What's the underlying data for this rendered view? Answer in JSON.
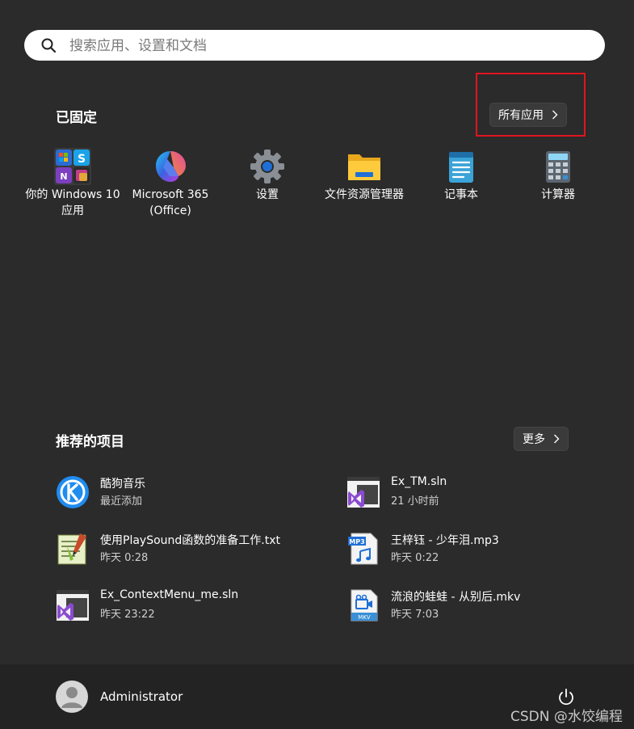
{
  "search": {
    "placeholder": "搜索应用、设置和文档"
  },
  "pinned": {
    "title": "已固定",
    "all_apps_label": "所有应用",
    "apps": [
      {
        "label_line1": "你的 Windows 10",
        "label_line2": "应用",
        "icon": "windows-10-apps-icon"
      },
      {
        "label_line1": "Microsoft 365",
        "label_line2": "(Office)",
        "icon": "microsoft-365-icon"
      },
      {
        "label_line1": "设置",
        "label_line2": "",
        "icon": "settings-gear-icon"
      },
      {
        "label_line1": "文件资源管理器",
        "label_line2": "",
        "icon": "file-explorer-icon"
      },
      {
        "label_line1": "记事本",
        "label_line2": "",
        "icon": "notepad-icon"
      },
      {
        "label_line1": "计算器",
        "label_line2": "",
        "icon": "calculator-icon"
      }
    ]
  },
  "recommended": {
    "title": "推荐的项目",
    "more_label": "更多",
    "items": [
      {
        "name": "酷狗音乐",
        "sub": "最近添加",
        "icon": "kugou-music-icon"
      },
      {
        "name": "Ex_TM.sln",
        "sub": "21 小时前",
        "icon": "visual-studio-solution-icon"
      },
      {
        "name": "使用PlaySound函数的准备工作.txt",
        "sub": "昨天 0:28",
        "icon": "text-file-icon"
      },
      {
        "name": "王梓钰 - 少年泪.mp3",
        "sub": "昨天 0:22",
        "icon": "mp3-file-icon"
      },
      {
        "name": "Ex_ContextMenu_me.sln",
        "sub": "昨天 23:22",
        "icon": "visual-studio-solution-icon"
      },
      {
        "name": "流浪的蛙蛙 - 从别后.mkv",
        "sub": "昨天 7:03",
        "icon": "mkv-file-icon"
      }
    ]
  },
  "footer": {
    "username": "Administrator",
    "watermark": "CSDN @水饺编程"
  },
  "colors": {
    "background": "#2b2b2b",
    "highlight": "#e0141e",
    "accent_blue": "#2b8cf2"
  }
}
